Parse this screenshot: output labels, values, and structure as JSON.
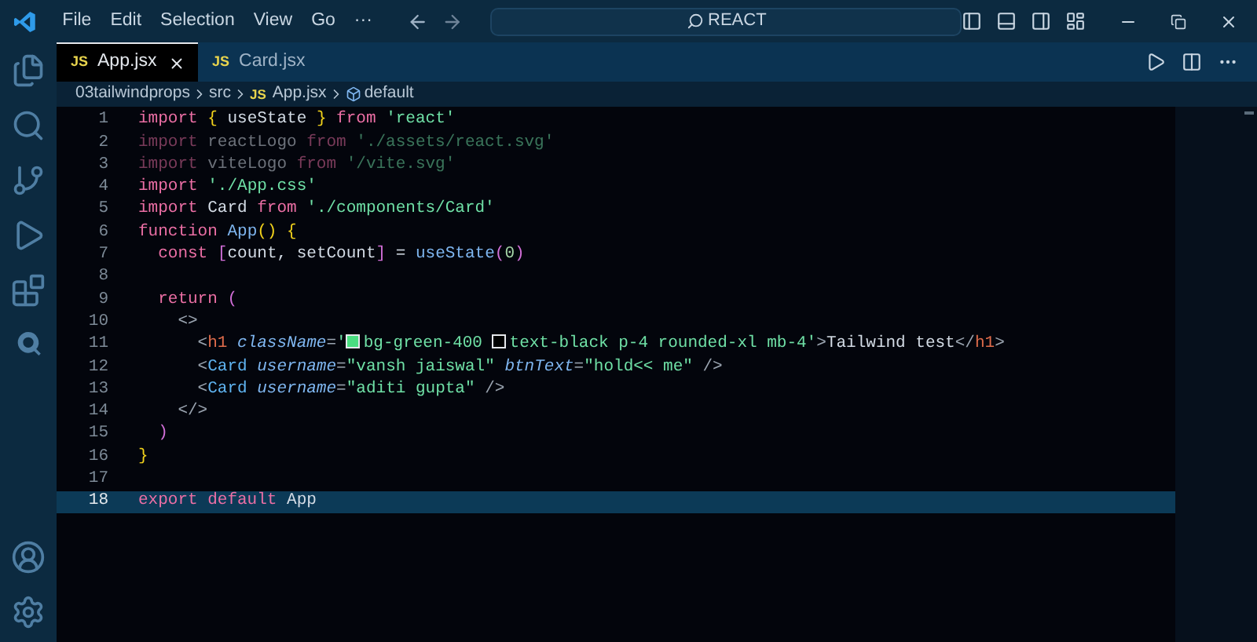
{
  "menu": [
    "File",
    "Edit",
    "Selection",
    "View",
    "Go",
    "···"
  ],
  "search": {
    "value": "REACT"
  },
  "tabs": [
    {
      "label": "App.jsx",
      "badge": "JS",
      "selected": true
    },
    {
      "label": "Card.jsx",
      "badge": "JS",
      "selected": false
    }
  ],
  "breadcrumbs": [
    {
      "kind": "folder",
      "label": "03tailwindprops"
    },
    {
      "kind": "folder",
      "label": "src"
    },
    {
      "kind": "file",
      "badge": "JS",
      "label": "App.jsx"
    },
    {
      "kind": "symbol",
      "label": "default"
    }
  ],
  "lines": [
    {
      "number": "1",
      "selected": false,
      "tokens": [
        {
          "kind": "keyword",
          "text": "import "
        },
        {
          "kind": "bracket",
          "text": "{"
        },
        {
          "kind": "ident",
          "text": " useState "
        },
        {
          "kind": "bracket",
          "text": "} "
        },
        {
          "kind": "keyword",
          "text": "from "
        },
        {
          "kind": "string",
          "text": "'react'"
        }
      ]
    },
    {
      "number": "2",
      "selected": false,
      "dimmed": true,
      "tokens": [
        {
          "kind": "keyword",
          "text": "import"
        },
        {
          "kind": "ident",
          "text": " reactLogo "
        },
        {
          "kind": "keyword",
          "text": "from "
        },
        {
          "kind": "string",
          "text": "'./assets/react.svg'"
        }
      ]
    },
    {
      "number": "3",
      "selected": false,
      "dimmed": true,
      "tokens": [
        {
          "kind": "keyword",
          "text": "import"
        },
        {
          "kind": "ident",
          "text": " viteLogo "
        },
        {
          "kind": "keyword",
          "text": "from "
        },
        {
          "kind": "string",
          "text": "'/vite.svg'"
        }
      ]
    },
    {
      "number": "4",
      "selected": false,
      "tokens": [
        {
          "kind": "keyword",
          "text": "import "
        },
        {
          "kind": "string",
          "text": "'./App.css'"
        }
      ]
    },
    {
      "number": "5",
      "selected": false,
      "tokens": [
        {
          "kind": "keyword",
          "text": "import"
        },
        {
          "kind": "ident",
          "text": " Card "
        },
        {
          "kind": "keyword",
          "text": "from "
        },
        {
          "kind": "string",
          "text": "'./components/Card'"
        }
      ]
    },
    {
      "number": "6",
      "selected": false,
      "tokens": [
        {
          "kind": "keyword",
          "text": "function "
        },
        {
          "kind": "func",
          "text": "App"
        },
        {
          "kind": "bracket",
          "text": "() {"
        }
      ]
    },
    {
      "number": "7",
      "selected": false,
      "tokens": [
        {
          "kind": "keyword",
          "text": "  const "
        },
        {
          "kind": "bracket2",
          "text": "["
        },
        {
          "kind": "ident",
          "text": "count, setCount"
        },
        {
          "kind": "bracket2",
          "text": "]"
        },
        {
          "kind": "ident",
          "text": " = "
        },
        {
          "kind": "func",
          "text": "useState"
        },
        {
          "kind": "bracket2",
          "text": "("
        },
        {
          "kind": "number",
          "text": "0"
        },
        {
          "kind": "bracket2",
          "text": ")"
        }
      ]
    },
    {
      "number": "8",
      "selected": false
    },
    {
      "number": "9",
      "selected": false,
      "tokens": [
        {
          "kind": "keyword",
          "text": "  return "
        },
        {
          "kind": "bracket2",
          "text": "("
        }
      ]
    },
    {
      "number": "10",
      "selected": false,
      "tokens": [
        {
          "kind": "punct",
          "text": "    <>"
        }
      ]
    },
    {
      "number": "11",
      "selected": false,
      "tokens": [
        {
          "kind": "punct",
          "text": "      <"
        },
        {
          "kind": "tag",
          "text": "h1 "
        },
        {
          "kind": "attr",
          "text": "className"
        },
        {
          "kind": "punct",
          "text": "="
        },
        {
          "kind": "string",
          "text": "'"
        },
        {
          "kind": "swatch",
          "color": "#4ade80"
        },
        {
          "kind": "string",
          "text": "bg-green-400 "
        },
        {
          "kind": "swatch",
          "color": "#000000"
        },
        {
          "kind": "string",
          "text": "text-black p-4 rounded-xl mb-4'"
        },
        {
          "kind": "punct",
          "text": ">"
        },
        {
          "kind": "plain",
          "text": "Tailwind test"
        },
        {
          "kind": "punct",
          "text": "</"
        },
        {
          "kind": "tag",
          "text": "h1"
        },
        {
          "kind": "punct",
          "text": ">"
        }
      ]
    },
    {
      "number": "12",
      "selected": false,
      "tokens": [
        {
          "kind": "punct",
          "text": "      <"
        },
        {
          "kind": "component",
          "text": "Card "
        },
        {
          "kind": "attr",
          "text": "username"
        },
        {
          "kind": "punct",
          "text": "="
        },
        {
          "kind": "string",
          "text": "\"vansh jaiswal\" "
        },
        {
          "kind": "attr",
          "text": "btnText"
        },
        {
          "kind": "punct",
          "text": "="
        },
        {
          "kind": "string",
          "text": "\"hold<< me\""
        },
        {
          "kind": "punct",
          "text": " />"
        }
      ]
    },
    {
      "number": "13",
      "selected": false,
      "tokens": [
        {
          "kind": "punct",
          "text": "      <"
        },
        {
          "kind": "component",
          "text": "Card "
        },
        {
          "kind": "attr",
          "text": "username"
        },
        {
          "kind": "punct",
          "text": "="
        },
        {
          "kind": "string",
          "text": "\"aditi gupta\""
        },
        {
          "kind": "punct",
          "text": " />"
        }
      ]
    },
    {
      "number": "14",
      "selected": false,
      "tokens": [
        {
          "kind": "punct",
          "text": "    </>"
        }
      ]
    },
    {
      "number": "15",
      "selected": false,
      "tokens": [
        {
          "kind": "bracket2",
          "text": "  )"
        }
      ]
    },
    {
      "number": "16",
      "selected": false,
      "tokens": [
        {
          "kind": "bracket",
          "text": "}"
        }
      ]
    },
    {
      "number": "17",
      "selected": false
    },
    {
      "number": "18",
      "selected": true,
      "tokens": [
        {
          "kind": "keyword",
          "text": "export default"
        },
        {
          "kind": "ident",
          "text": " App"
        }
      ]
    }
  ]
}
